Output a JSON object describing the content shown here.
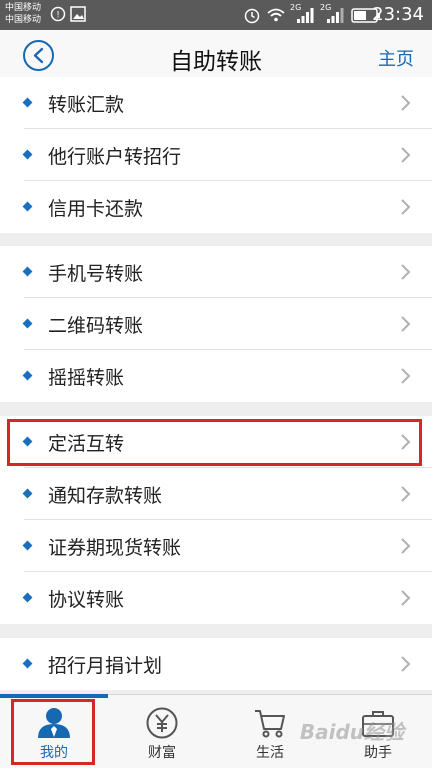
{
  "status_bar": {
    "carrier_1": "中国移动",
    "carrier_2": "中国移动",
    "network_1": "2G",
    "network_2": "2G",
    "time": "23:34"
  },
  "header": {
    "title": "自助转账",
    "home_label": "主页"
  },
  "groups": [
    {
      "items": [
        {
          "label": "转账汇款"
        },
        {
          "label": "他行账户转招行"
        },
        {
          "label": "信用卡还款"
        }
      ]
    },
    {
      "items": [
        {
          "label": "手机号转账"
        },
        {
          "label": "二维码转账"
        },
        {
          "label": "摇摇转账"
        }
      ]
    },
    {
      "items": [
        {
          "label": "定活互转"
        },
        {
          "label": "通知存款转账"
        },
        {
          "label": "证券期现货转账"
        },
        {
          "label": "协议转账"
        }
      ]
    },
    {
      "items": [
        {
          "label": "招行月捐计划"
        }
      ]
    }
  ],
  "tabbar": {
    "tabs": [
      {
        "label": "我的"
      },
      {
        "label": "财富"
      },
      {
        "label": "生活"
      },
      {
        "label": "助手"
      }
    ]
  },
  "colors": {
    "accent": "#1768b3",
    "highlight": "#d42828"
  },
  "watermark": "Baidu经验"
}
